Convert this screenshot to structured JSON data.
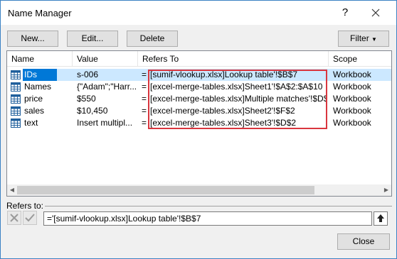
{
  "window": {
    "title": "Name Manager",
    "help": "?"
  },
  "toolbar": {
    "new_label": "New...",
    "edit_label": "Edit...",
    "delete_label": "Delete",
    "filter_label": "Filter"
  },
  "columns": {
    "name": "Name",
    "value": "Value",
    "refers_to": "Refers To",
    "scope": "Scope"
  },
  "rows": [
    {
      "name": "IDs",
      "value": "s-006",
      "eq": "=",
      "refers": "[sumif-vlookup.xlsx]Lookup table'!$B$7",
      "scope": "Workbook",
      "selected": true
    },
    {
      "name": "Names",
      "value": "{\"Adam\";\"Harr...",
      "eq": "=",
      "refers": "[excel-merge-tables.xlsx]Sheet1'!$A$2:$A$10",
      "scope": "Workbook",
      "selected": false
    },
    {
      "name": "price",
      "value": "$550",
      "eq": "=",
      "refers": "[excel-merge-tables.xlsx]Multiple matches'!$D$4",
      "scope": "Workbook",
      "selected": false
    },
    {
      "name": "sales",
      "value": "$10,450",
      "eq": "=",
      "refers": "[excel-merge-tables.xlsx]Sheet2'!$F$2",
      "scope": "Workbook",
      "selected": false
    },
    {
      "name": "text",
      "value": "Insert multipl...",
      "eq": "=",
      "refers": "[excel-merge-tables.xlsx]Sheet3'!$D$2",
      "scope": "Workbook",
      "selected": false
    }
  ],
  "refers_to": {
    "label": "Refers to:",
    "value": "='[sumif-vlookup.xlsx]Lookup table'!$B$7"
  },
  "footer": {
    "close_label": "Close"
  },
  "colors": {
    "accent": "#0078d7",
    "highlight_box": "#d9363e"
  }
}
